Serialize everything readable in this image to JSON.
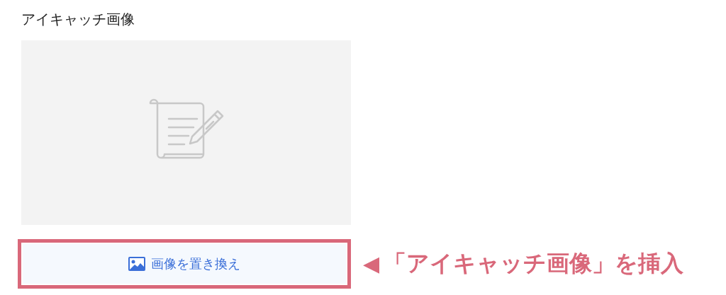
{
  "section": {
    "title": "アイキャッチ画像"
  },
  "button": {
    "label": "画像を置き換え"
  },
  "annotation": {
    "pointer": "◀",
    "text": "「アイキャッチ画像」を挿入"
  }
}
